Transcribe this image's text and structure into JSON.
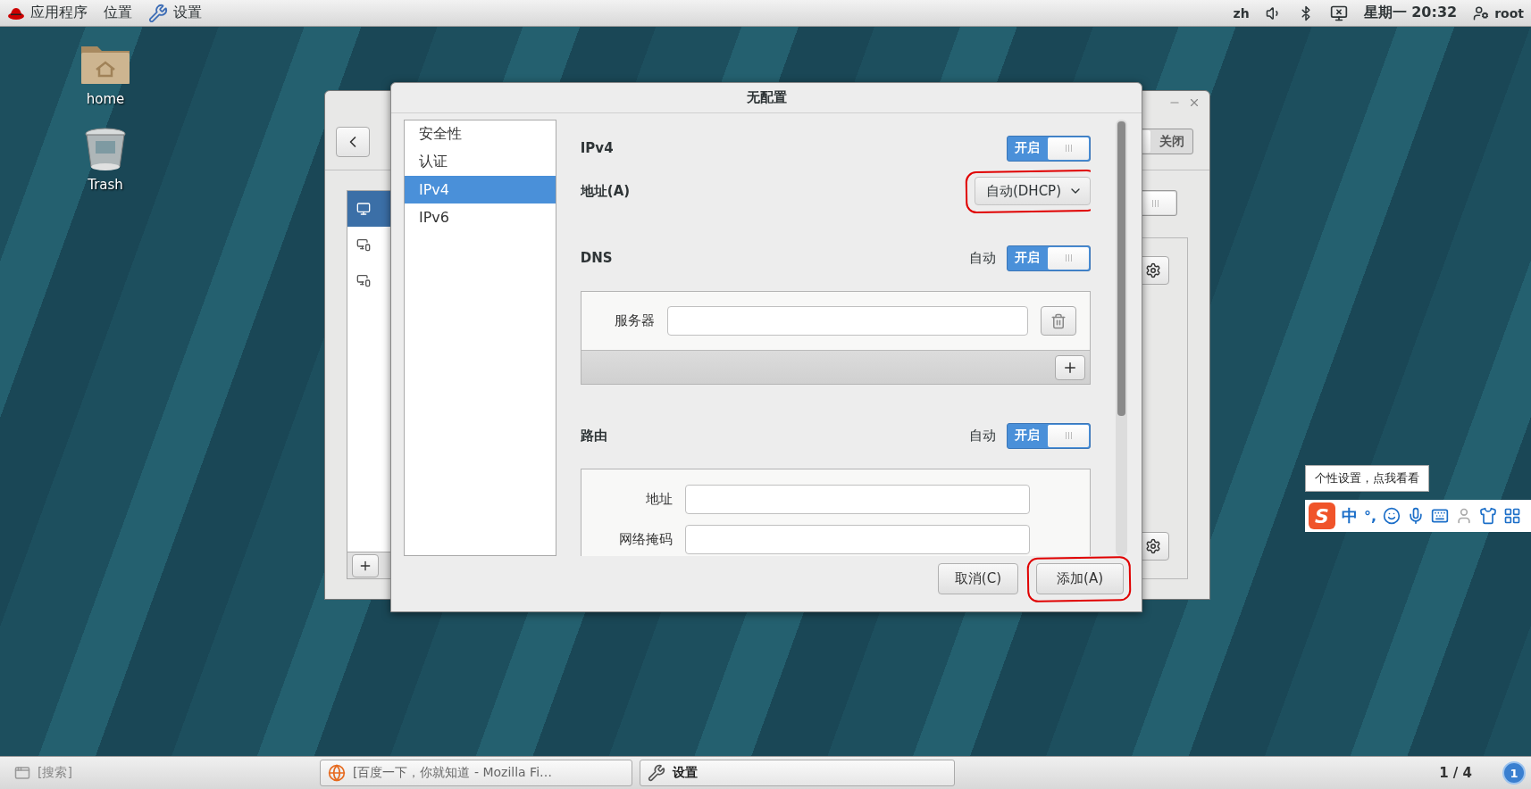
{
  "top_bar": {
    "menus": [
      {
        "label": "应用程序",
        "kind": "apps"
      },
      {
        "label": "位置",
        "kind": "places"
      },
      {
        "label": "设置",
        "kind": "settings"
      }
    ],
    "input_method": "zh",
    "clock": "星期一 20:32",
    "user": "root"
  },
  "desktop_icons": [
    {
      "label": "home",
      "kind": "home"
    },
    {
      "label": "Trash",
      "kind": "trash"
    }
  ],
  "background_window": {
    "header_switch": {
      "on": false,
      "text": "关闭"
    },
    "panel_switch": {
      "on": false
    },
    "sidebar_items": [
      {
        "selected": true
      },
      {
        "selected": false
      },
      {
        "selected": false
      }
    ]
  },
  "dialog": {
    "title": "无配置",
    "sidebar": [
      {
        "label": "安全性",
        "selected": false
      },
      {
        "label": "认证",
        "selected": false
      },
      {
        "label": "IPv4",
        "selected": true
      },
      {
        "label": "IPv6",
        "selected": false
      }
    ],
    "ipv4": {
      "label": "IPv4",
      "on": true,
      "switch_text": "开启"
    },
    "address": {
      "label": "地址(A)",
      "value": "自动(DHCP)",
      "highlighted": true
    },
    "dns": {
      "label": "DNS",
      "auto_label": "自动",
      "on": true,
      "switch_text": "开启",
      "server_label": "服务器"
    },
    "routes": {
      "label": "路由",
      "auto_label": "自动",
      "on": true,
      "switch_text": "开启",
      "fields": [
        {
          "label": "地址"
        },
        {
          "label": "网络掩码"
        }
      ]
    },
    "buttons": [
      {
        "label": "取消(C)",
        "highlighted": false
      },
      {
        "label": "添加(A)",
        "highlighted": true
      }
    ]
  },
  "ime": {
    "tooltip": "个性设置，点我看看",
    "logo": "S",
    "mode": "中",
    "punctuation": "°,"
  },
  "taskbar": {
    "search": "[搜索]",
    "windows": [
      {
        "label": "[百度一下，你就知道 - Mozilla Fi…",
        "kind": "browser"
      },
      {
        "label": "设置",
        "kind": "settings"
      }
    ],
    "workspace": "1 / 4",
    "notifications": "1"
  }
}
